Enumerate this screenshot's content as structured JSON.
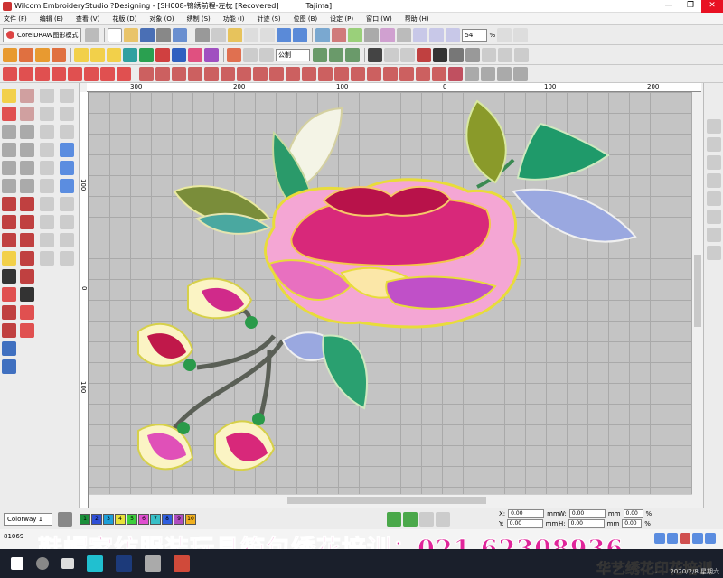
{
  "window": {
    "title": "Wilcom EmbroideryStudio ?Designing - [SH008-锦绣前程-左枕 [Recovered]",
    "machine": "Tajima]"
  },
  "menu": [
    "文件 (F)",
    "编辑 (E)",
    "查看 (V)",
    "花版 (D)",
    "对象 (O)",
    "绣制 (S)",
    "功能 (I)",
    "针迹 (S)",
    "位图 (B)",
    "设定 (P)",
    "窗口 (W)",
    "帮助 (H)"
  ],
  "toolbar": {
    "corel_label": "CorelDRAW图形模式",
    "zoom_value": "54",
    "zoom_unit": "%",
    "stitch_combo": "公制"
  },
  "ruler": {
    "h_ticks": [
      "300",
      "200",
      "100",
      "0",
      "100",
      "200"
    ],
    "v_ticks": [
      "100",
      "0",
      "100"
    ]
  },
  "colorway": {
    "label": "Colorway 1",
    "swatches": [
      {
        "n": "1",
        "color": "#1a8f3a"
      },
      {
        "n": "2",
        "color": "#2e4fd6"
      },
      {
        "n": "3",
        "color": "#1d9fd8"
      },
      {
        "n": "4",
        "color": "#e8e23a"
      },
      {
        "n": "5",
        "color": "#3ccf3c"
      },
      {
        "n": "6",
        "color": "#e04fd0"
      },
      {
        "n": "7",
        "color": "#38c0c8"
      },
      {
        "n": "8",
        "color": "#2f5fe0"
      },
      {
        "n": "9",
        "color": "#b04ec0"
      },
      {
        "n": "10",
        "color": "#f0b020"
      }
    ]
  },
  "coords": {
    "x_label": "X:",
    "x_value": "0.00",
    "x_unit": "mm",
    "y_label": "Y:",
    "y_value": "0.00",
    "y_unit": "mm",
    "w_label": "W:",
    "w_value": "0.00",
    "w_unit": "mm",
    "w_pct": "0.00",
    "pct_unit": "%",
    "h_label": "H:",
    "h_value": "0.00",
    "h_unit": "mm",
    "h_pct": "0.00"
  },
  "status": {
    "stitch_count": "81069"
  },
  "watermark": {
    "main": "鞋帽家纺服装玩具箱包绣花培训：021 62308936",
    "secondary": "华艺绣花印花培训"
  },
  "taskbar": {
    "datetime": "2020/2/8 星期六"
  }
}
